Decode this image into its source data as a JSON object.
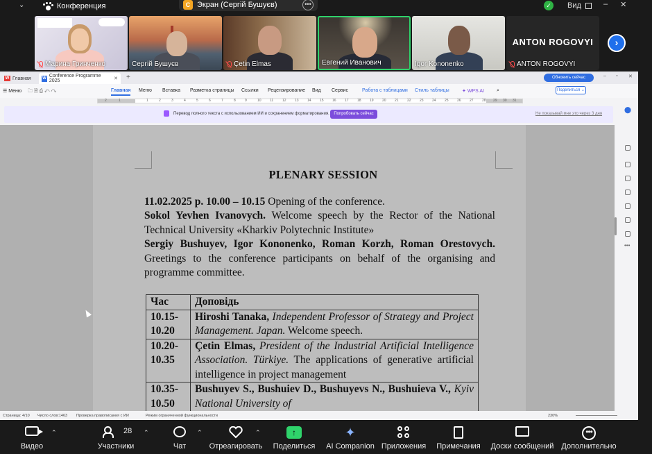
{
  "zoom": {
    "meeting_title": "Конференция",
    "screen_share_label": "Экран (Сергій Бушуєв)",
    "share_badge": "С",
    "view_label": "Вид",
    "participants": [
      {
        "name": "Марина Гринченко",
        "muted": true
      },
      {
        "name": "Сергій Бушуєв",
        "muted": false
      },
      {
        "name": "Çetin Elmas",
        "muted": true
      },
      {
        "name": "Евгений Иванович",
        "muted": false,
        "active": true
      },
      {
        "name": "Igor Kononenko",
        "muted": false
      },
      {
        "name": "ANTON ROGOVYI",
        "muted": true,
        "big_label": "ANTON ROGOVYI"
      }
    ],
    "participants_count": "28",
    "toolbar": [
      {
        "label": "Видео",
        "icon": "video-camera-icon"
      },
      {
        "label": "Участники",
        "icon": "participants-icon"
      },
      {
        "label": "Чат",
        "icon": "chat-icon"
      },
      {
        "label": "Отреагировать",
        "icon": "heart-icon"
      },
      {
        "label": "Поделиться",
        "icon": "share-screen-icon"
      },
      {
        "label": "AI Companion",
        "icon": "ai-sparkle-icon"
      },
      {
        "label": "Приложения",
        "icon": "apps-icon"
      },
      {
        "label": "Примечания",
        "icon": "notes-icon"
      },
      {
        "label": "Доски сообщений",
        "icon": "whiteboard-icon"
      },
      {
        "label": "Дополнительно",
        "icon": "more-icon"
      }
    ]
  },
  "wps": {
    "home_tab": "Главная",
    "doc_tab": "Conference Programme 2025",
    "upgrade_label": "Обновить сейчас",
    "menu_label": "Меню",
    "ribbon": [
      "Главная",
      "Меню",
      "Вставка",
      "Разметка страницы",
      "Ссылки",
      "Рецензирование",
      "Вид",
      "Сервис",
      "Работа с таблицами",
      "Стиль таблицы",
      "WPS AI"
    ],
    "share_label": "Поделиться",
    "ruler_marks": [
      "2",
      "1",
      "1",
      "2",
      "3",
      "4",
      "5",
      "6",
      "7",
      "8",
      "9",
      "10",
      "11",
      "12",
      "13",
      "14",
      "15",
      "16",
      "17",
      "18",
      "19",
      "20",
      "21",
      "22",
      "23",
      "24",
      "25",
      "26",
      "27",
      "28",
      "29",
      "30",
      "31"
    ],
    "ai_banner_text": "Перевод полного текста с использованием ИИ и сохранением форматирования.",
    "ai_banner_button": "Попробовать сейчас",
    "ai_banner_hide": "Не показывай мне это через 3 дня",
    "status": {
      "page": "Страница: 4/10",
      "words": "Число слов:1463",
      "spell": "Проверка правописания с ИИ",
      "mode": "Режим ограниченной функциональности",
      "zoom": "230%"
    }
  },
  "document": {
    "title": "PLENARY SESSION",
    "opening_date": "11.02.2025 р. 10.00 – 10.15",
    "opening_text": " Opening of the conference.",
    "welcome_name": "Sokol Yevhen Ivanovych.",
    "welcome_text": " Welcome speech by the Rector of the National Technical University «Kharkiv Polytechnic Institute»",
    "greet_names": "Sergiy Bushuyev, Igor Kononenko, Roman Korzh, Roman Orestovych.",
    "greet_text": " Greetings to the conference participants on behalf of the organising and programme committee.",
    "table_headers": [
      "Час",
      "Доповідь"
    ],
    "rows": [
      {
        "time": "10.15-10.20",
        "name": "Hiroshi Tanaka,",
        "affil": " Independent Professor of Strategy and Project Management. Japan.",
        "topic": " Welcome speech."
      },
      {
        "time": "10.20-10.35",
        "name": "Çetin Elmas,",
        "affil": " President of the Industrial Artificial Intelligence Association. Türkiye.",
        "topic": " The applications of generative artificial intelligence in project management"
      },
      {
        "time": "10.35-10.50",
        "name": "Bushuyev S., Bushuiev D., Bushuyevs N., Bushuieva V.,",
        "affil": " Kyiv National University of",
        "topic": ""
      }
    ]
  }
}
